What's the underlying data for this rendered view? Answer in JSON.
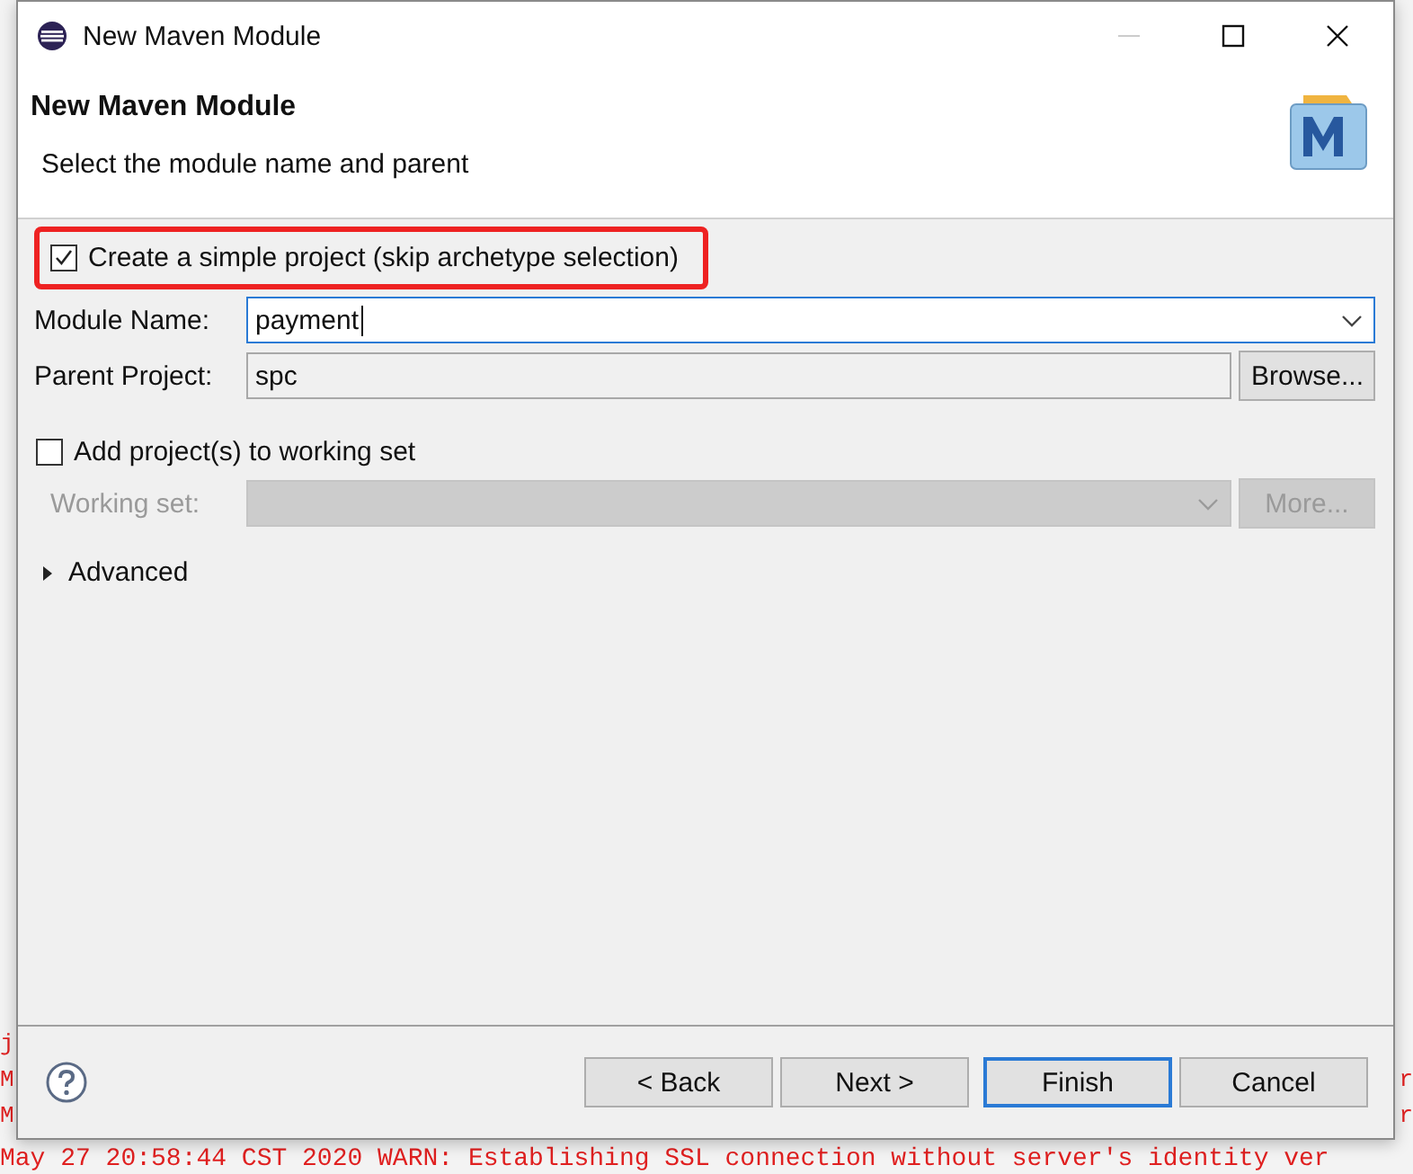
{
  "window": {
    "title": "New Maven Module"
  },
  "header": {
    "title": "New Maven Module",
    "subtitle": "Select the module name and parent"
  },
  "simple_project": {
    "label": "Create a simple project (skip archetype selection)",
    "checked": true,
    "highlighted": true
  },
  "fields": [
    {
      "kind": "combo",
      "label": "Module Name:",
      "value": "payment",
      "focused": true
    },
    {
      "kind": "text",
      "label": "Parent Project:",
      "value": "spc",
      "focused": false,
      "button": "Browse..."
    }
  ],
  "working_set": {
    "label": "Add project(s) to working set",
    "checked": false,
    "set_label": "Working set:",
    "more": "More...",
    "disabled": true
  },
  "advanced": {
    "label": "Advanced",
    "expanded": false
  },
  "buttons": [
    {
      "label": "< Back",
      "default": false
    },
    {
      "label": "Next >",
      "default": false
    },
    {
      "label": "Finish",
      "default": true
    },
    {
      "label": "Cancel",
      "default": false
    }
  ],
  "console": {
    "left_fragments": [
      "j",
      "M",
      "M"
    ],
    "right_fragments": [
      "r",
      "r"
    ],
    "last_line": "May 27 20:58:44 CST 2020 WARN: Establishing SSL connection without server's identity ver"
  }
}
